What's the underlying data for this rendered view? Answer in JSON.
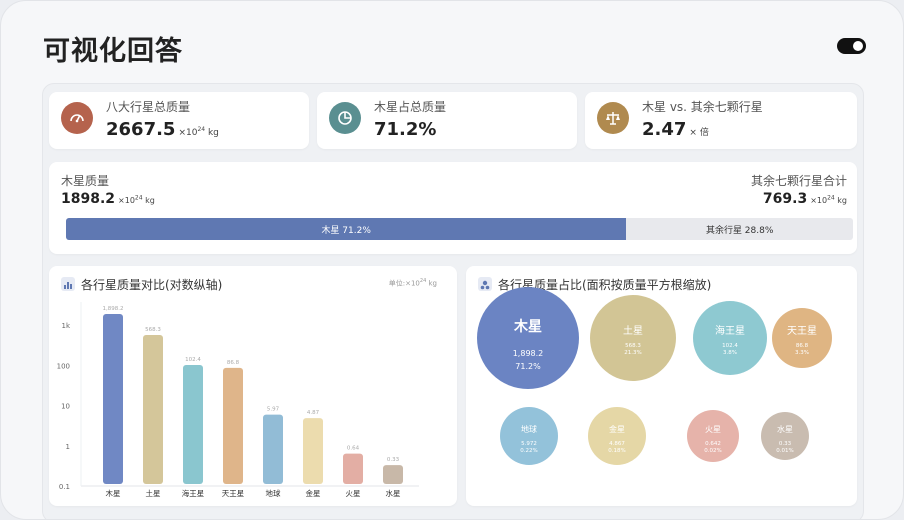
{
  "header": {
    "title": "可视化回答"
  },
  "stats": [
    {
      "label": "八大行星总质量",
      "value": "2667.5",
      "unit_prefix": "×10",
      "unit_exp": "24",
      "unit_suffix": " kg",
      "icon": "gauge-icon",
      "color": "#b5634d"
    },
    {
      "label": "木星占总质量",
      "value": "71.2%",
      "unit_prefix": "",
      "unit_exp": "",
      "unit_suffix": "",
      "icon": "pie-chart-icon",
      "color": "#5a8f91"
    },
    {
      "label": "木星 vs. 其余七颗行星",
      "value": "2.47",
      "unit_prefix": "× 倍",
      "unit_exp": "",
      "unit_suffix": "",
      "icon": "scale-icon",
      "color": "#b08a4f"
    }
  ],
  "comparison": {
    "left_label": "木星质量",
    "left_value": "1898.2",
    "left_unit_prefix": "×10",
    "left_unit_exp": "24",
    "left_unit_suffix": " kg",
    "right_label": "其余七颗行星合计",
    "right_value": "769.3",
    "right_unit_prefix": "×10",
    "right_unit_exp": "24",
    "right_unit_suffix": " kg",
    "jupiter_bar_label": "木星 71.2%",
    "rest_bar_label": "其余行星 28.8%",
    "jupiter_share": 0.712
  },
  "bar_card": {
    "title": "各行星质量对比(对数纵轴)",
    "unit_prefix": "单位:×10",
    "unit_exp": "24",
    "unit_suffix": " kg",
    "icon": "bar-chart-icon"
  },
  "bubble_card": {
    "title": "各行星质量占比(面积按质量平方根缩放)",
    "icon": "bubble-chart-icon"
  },
  "chart_data": [
    {
      "type": "bar",
      "title": "各行星质量对比(对数纵轴)",
      "ylabel": "",
      "xlabel": "",
      "y_scale": "log",
      "ylim": [
        0.1,
        3000
      ],
      "y_ticks": [
        {
          "value": 1000,
          "label": "1k"
        },
        {
          "value": 100,
          "label": "100"
        },
        {
          "value": 10,
          "label": "10"
        },
        {
          "value": 1,
          "label": "1"
        },
        {
          "value": 0.1,
          "label": "0.1"
        }
      ],
      "categories": [
        "木星",
        "土星",
        "海王星",
        "天王星",
        "地球",
        "金星",
        "火星",
        "水星"
      ],
      "values": [
        1898.2,
        568.3,
        102.4,
        86.8,
        5.97,
        4.87,
        0.64,
        0.33
      ],
      "value_labels": [
        "1,898.2",
        "568.3",
        "102.4",
        "86.8",
        "5.97",
        "4.87",
        "0.64",
        "0.33"
      ],
      "colors": [
        "#7088c4",
        "#d4c69a",
        "#8ac6cf",
        "#dfb58a",
        "#92bcd6",
        "#ecdcae",
        "#e3aea4",
        "#c8b8a8"
      ]
    },
    {
      "type": "bubble",
      "title": "各行星质量占比(面积按质量平方根缩放)",
      "items": [
        {
          "name": "木星",
          "value": "1,898.2",
          "share": "71.2%",
          "mass": 1898.2,
          "color": "#6b84c3"
        },
        {
          "name": "土星",
          "value": "568.3",
          "share": "21.3%",
          "mass": 568.3,
          "color": "#d2c595"
        },
        {
          "name": "海王星",
          "value": "102.4",
          "share": "3.8%",
          "mass": 102.4,
          "color": "#8ec9d1"
        },
        {
          "name": "天王星",
          "value": "86.8",
          "share": "3.3%",
          "mass": 86.8,
          "color": "#dfb583"
        },
        {
          "name": "地球",
          "value": "5.972",
          "share": "0.22%",
          "mass": 5.972,
          "color": "#93c2da"
        },
        {
          "name": "金星",
          "value": "4.867",
          "share": "0.18%",
          "mass": 4.867,
          "color": "#e5d7a6"
        },
        {
          "name": "火星",
          "value": "0.642",
          "share": "0.02%",
          "mass": 0.642,
          "color": "#e6b3aa"
        },
        {
          "name": "水星",
          "value": "0.33",
          "share": "0.01%",
          "mass": 0.33,
          "color": "#c9bcb0"
        }
      ]
    }
  ]
}
